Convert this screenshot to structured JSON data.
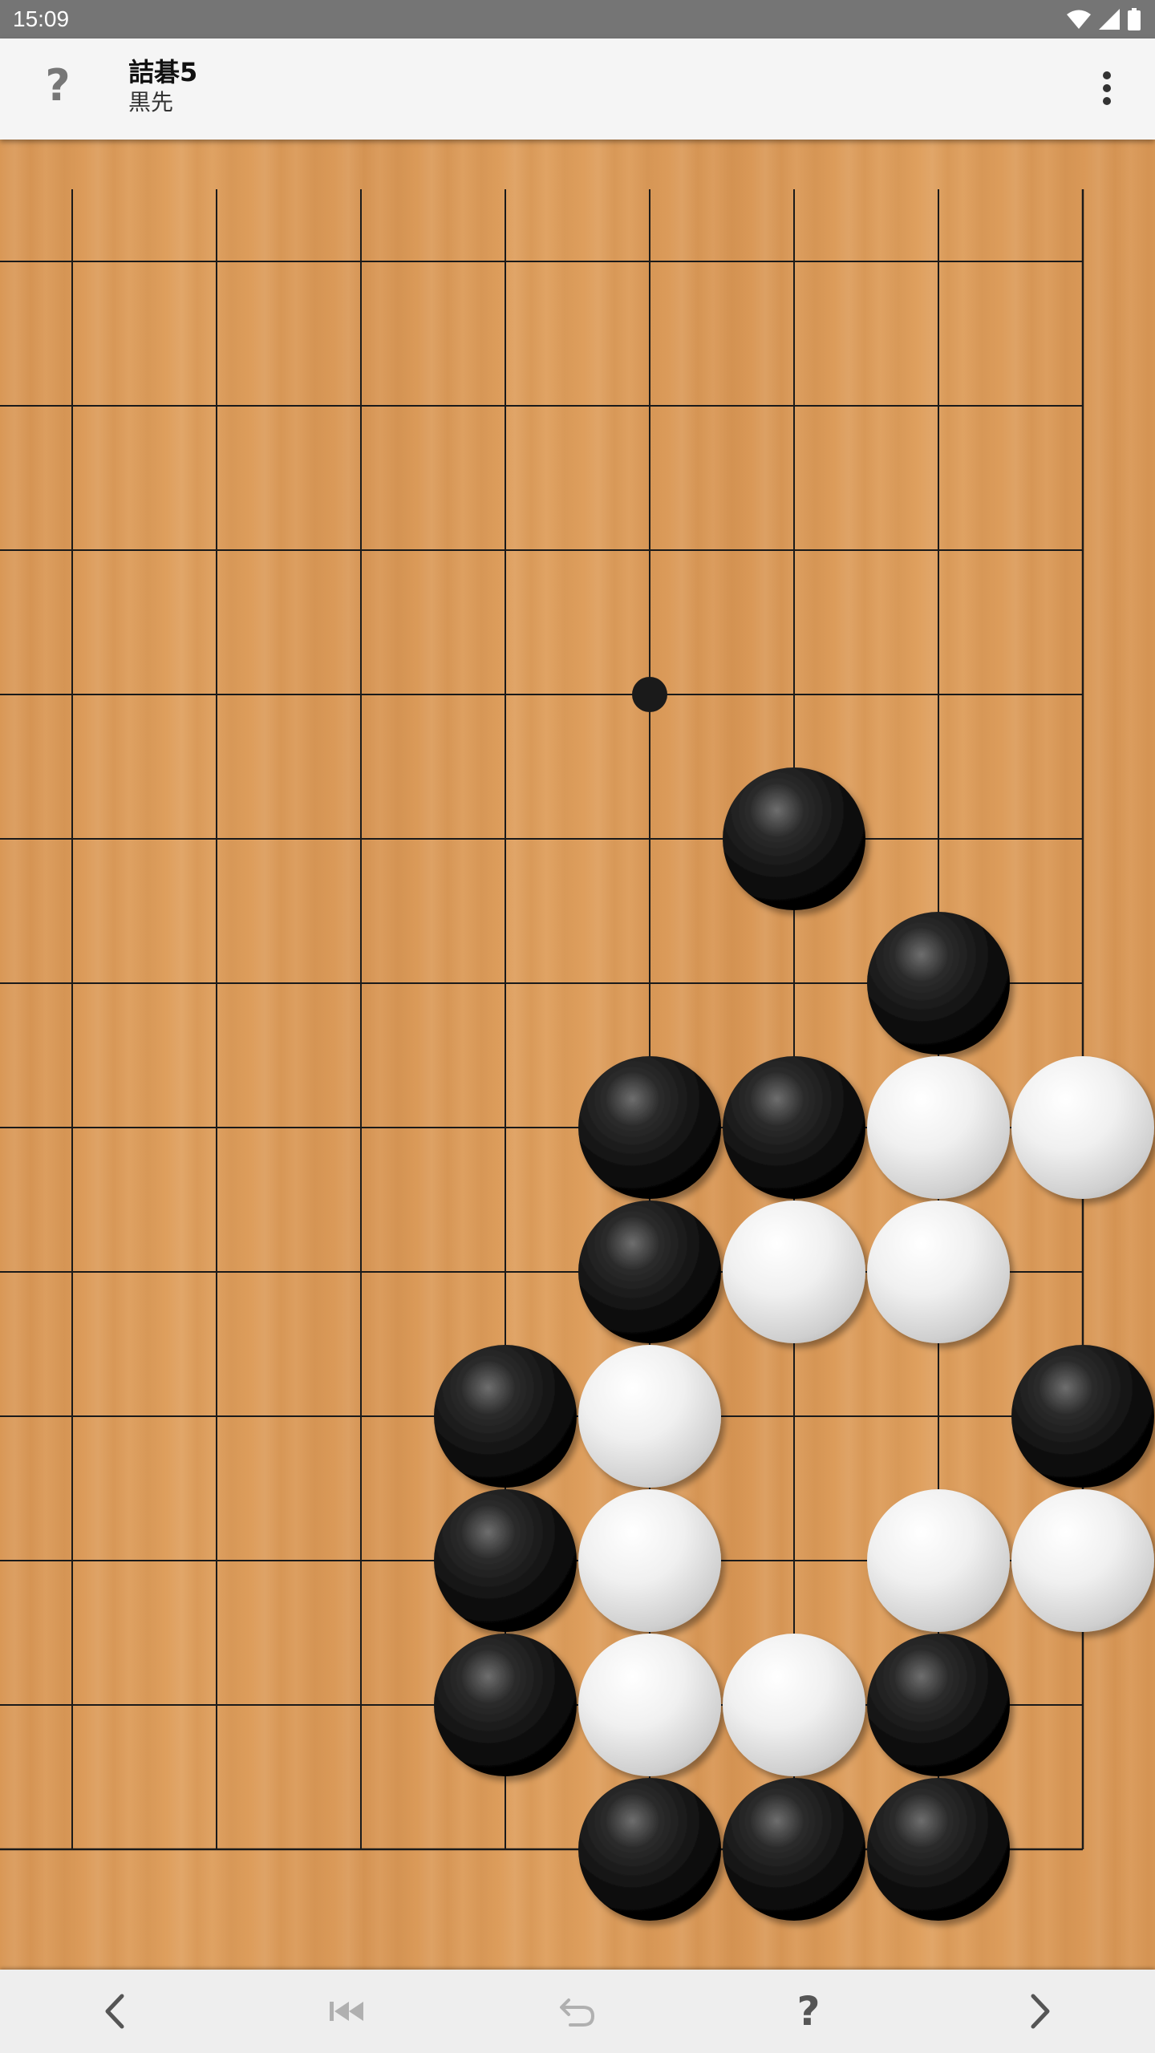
{
  "status_bar": {
    "time": "15:09",
    "icons": [
      "wifi-icon",
      "cell-signal-icon",
      "battery-icon"
    ]
  },
  "app_bar": {
    "help_icon": "?",
    "title": "詰碁5",
    "subtitle": "黒先",
    "overflow_icon": "more-vert-icon"
  },
  "board": {
    "columns_visible": 8,
    "rows_visible": 12,
    "colors": {
      "wood": "#dd9c5a",
      "line": "#1a1a1a",
      "black_stone": "#111111",
      "white_stone": "#e6e6e6"
    },
    "star_points": [
      {
        "col": 4,
        "row": 3
      }
    ],
    "stones": [
      {
        "col": 5,
        "row": 4,
        "color": "black"
      },
      {
        "col": 6,
        "row": 5,
        "color": "black"
      },
      {
        "col": 4,
        "row": 6,
        "color": "black"
      },
      {
        "col": 5,
        "row": 6,
        "color": "black"
      },
      {
        "col": 6,
        "row": 6,
        "color": "white"
      },
      {
        "col": 7,
        "row": 6,
        "color": "white"
      },
      {
        "col": 4,
        "row": 7,
        "color": "black"
      },
      {
        "col": 5,
        "row": 7,
        "color": "white"
      },
      {
        "col": 6,
        "row": 7,
        "color": "white"
      },
      {
        "col": 3,
        "row": 8,
        "color": "black"
      },
      {
        "col": 4,
        "row": 8,
        "color": "white"
      },
      {
        "col": 7,
        "row": 8,
        "color": "black"
      },
      {
        "col": 3,
        "row": 9,
        "color": "black"
      },
      {
        "col": 4,
        "row": 9,
        "color": "white"
      },
      {
        "col": 6,
        "row": 9,
        "color": "white"
      },
      {
        "col": 7,
        "row": 9,
        "color": "white"
      },
      {
        "col": 3,
        "row": 10,
        "color": "black"
      },
      {
        "col": 4,
        "row": 10,
        "color": "white"
      },
      {
        "col": 5,
        "row": 10,
        "color": "white"
      },
      {
        "col": 6,
        "row": 10,
        "color": "black"
      },
      {
        "col": 4,
        "row": 11,
        "color": "black"
      },
      {
        "col": 5,
        "row": 11,
        "color": "black"
      },
      {
        "col": 6,
        "row": 11,
        "color": "black"
      }
    ]
  },
  "bottom_nav": {
    "buttons": [
      {
        "name": "previous-button",
        "icon": "chevron-left-icon",
        "enabled": true
      },
      {
        "name": "rewind-button",
        "icon": "skip-to-start-icon",
        "enabled": false
      },
      {
        "name": "undo-button",
        "icon": "undo-icon",
        "enabled": false
      },
      {
        "name": "hint-button",
        "icon": "?",
        "enabled": true
      },
      {
        "name": "next-button",
        "icon": "chevron-right-icon",
        "enabled": true
      }
    ]
  }
}
